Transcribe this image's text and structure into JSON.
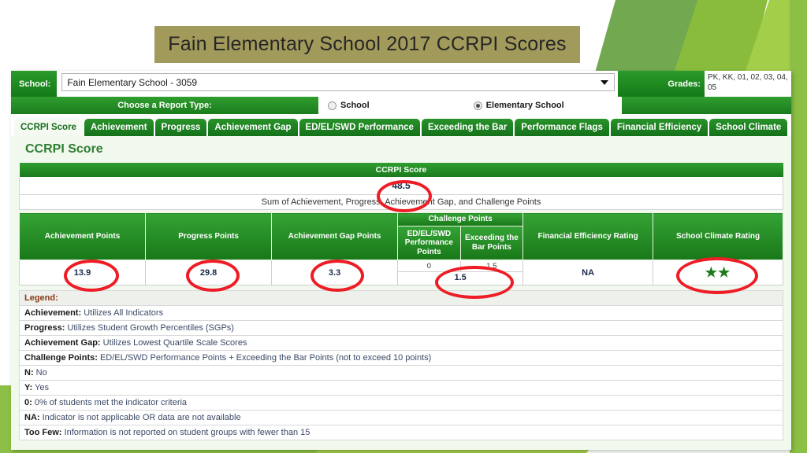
{
  "title": "Fain Elementary School 2017 CCRPI Scores",
  "toolbar": {
    "school_label": "School:",
    "school_value": "Fain Elementary School - 3059",
    "grades_label": "Grades:",
    "grades_value": "PK, KK, 01, 02, 03, 04, 05"
  },
  "report_type": {
    "prompt": "Choose a Report Type:",
    "options": [
      {
        "label": "School",
        "selected": false
      },
      {
        "label": "Elementary School",
        "selected": true
      }
    ]
  },
  "tabs": [
    {
      "label": "CCRPI Score",
      "active": true
    },
    {
      "label": "Achievement",
      "active": false
    },
    {
      "label": "Progress",
      "active": false
    },
    {
      "label": "Achievement Gap",
      "active": false
    },
    {
      "label": "ED/EL/SWD Performance",
      "active": false
    },
    {
      "label": "Exceeding the Bar",
      "active": false
    },
    {
      "label": "Performance Flags",
      "active": false
    },
    {
      "label": "Financial Efficiency",
      "active": false
    },
    {
      "label": "School Climate",
      "active": false
    }
  ],
  "section_title": "CCRPI Score",
  "ccrpi": {
    "header": "CCRPI Score",
    "value": "48.5",
    "subtitle": "Sum of Achievement, Progress, Achievement Gap, and Challenge Points"
  },
  "points_table": {
    "group_header": "Challenge Points",
    "headers": {
      "achievement": "Achievement Points",
      "progress": "Progress Points",
      "gap": "Achievement Gap Points",
      "edelswd": "ED/EL/SWD Performance Points",
      "exceeding": "Exceeding the Bar Points",
      "financial": "Financial Efficiency Rating",
      "climate": "School Climate Rating"
    },
    "values": {
      "achievement": "13.9",
      "progress": "29.8",
      "gap": "3.3",
      "edelswd": "0",
      "exceeding": "1.5",
      "challenge_total": "1.5",
      "financial": "NA",
      "climate_stars": "★★",
      "climate_star_count": 2
    }
  },
  "legend": {
    "title": "Legend:",
    "rows": [
      {
        "term": "Achievement:",
        "desc": "Utilizes All Indicators"
      },
      {
        "term": "Progress:",
        "desc": "Utilizes Student Growth Percentiles (SGPs)"
      },
      {
        "term": "Achievement Gap:",
        "desc": "Utilizes Lowest Quartile Scale Scores"
      },
      {
        "term": "Challenge Points:",
        "desc": "ED/EL/SWD Performance Points + Exceeding the Bar Points (not to exceed 10 points)"
      },
      {
        "term": "N:",
        "desc": "No"
      },
      {
        "term": "Y:",
        "desc": "Yes"
      },
      {
        "term": "0:",
        "desc": "0% of students met the indicator criteria"
      },
      {
        "term": "NA:",
        "desc": "Indicator is not applicable OR data are not available"
      },
      {
        "term": "Too Few:",
        "desc": "Information is not reported on student groups with fewer than 15"
      }
    ]
  },
  "annotation_color": "#ee1c25"
}
